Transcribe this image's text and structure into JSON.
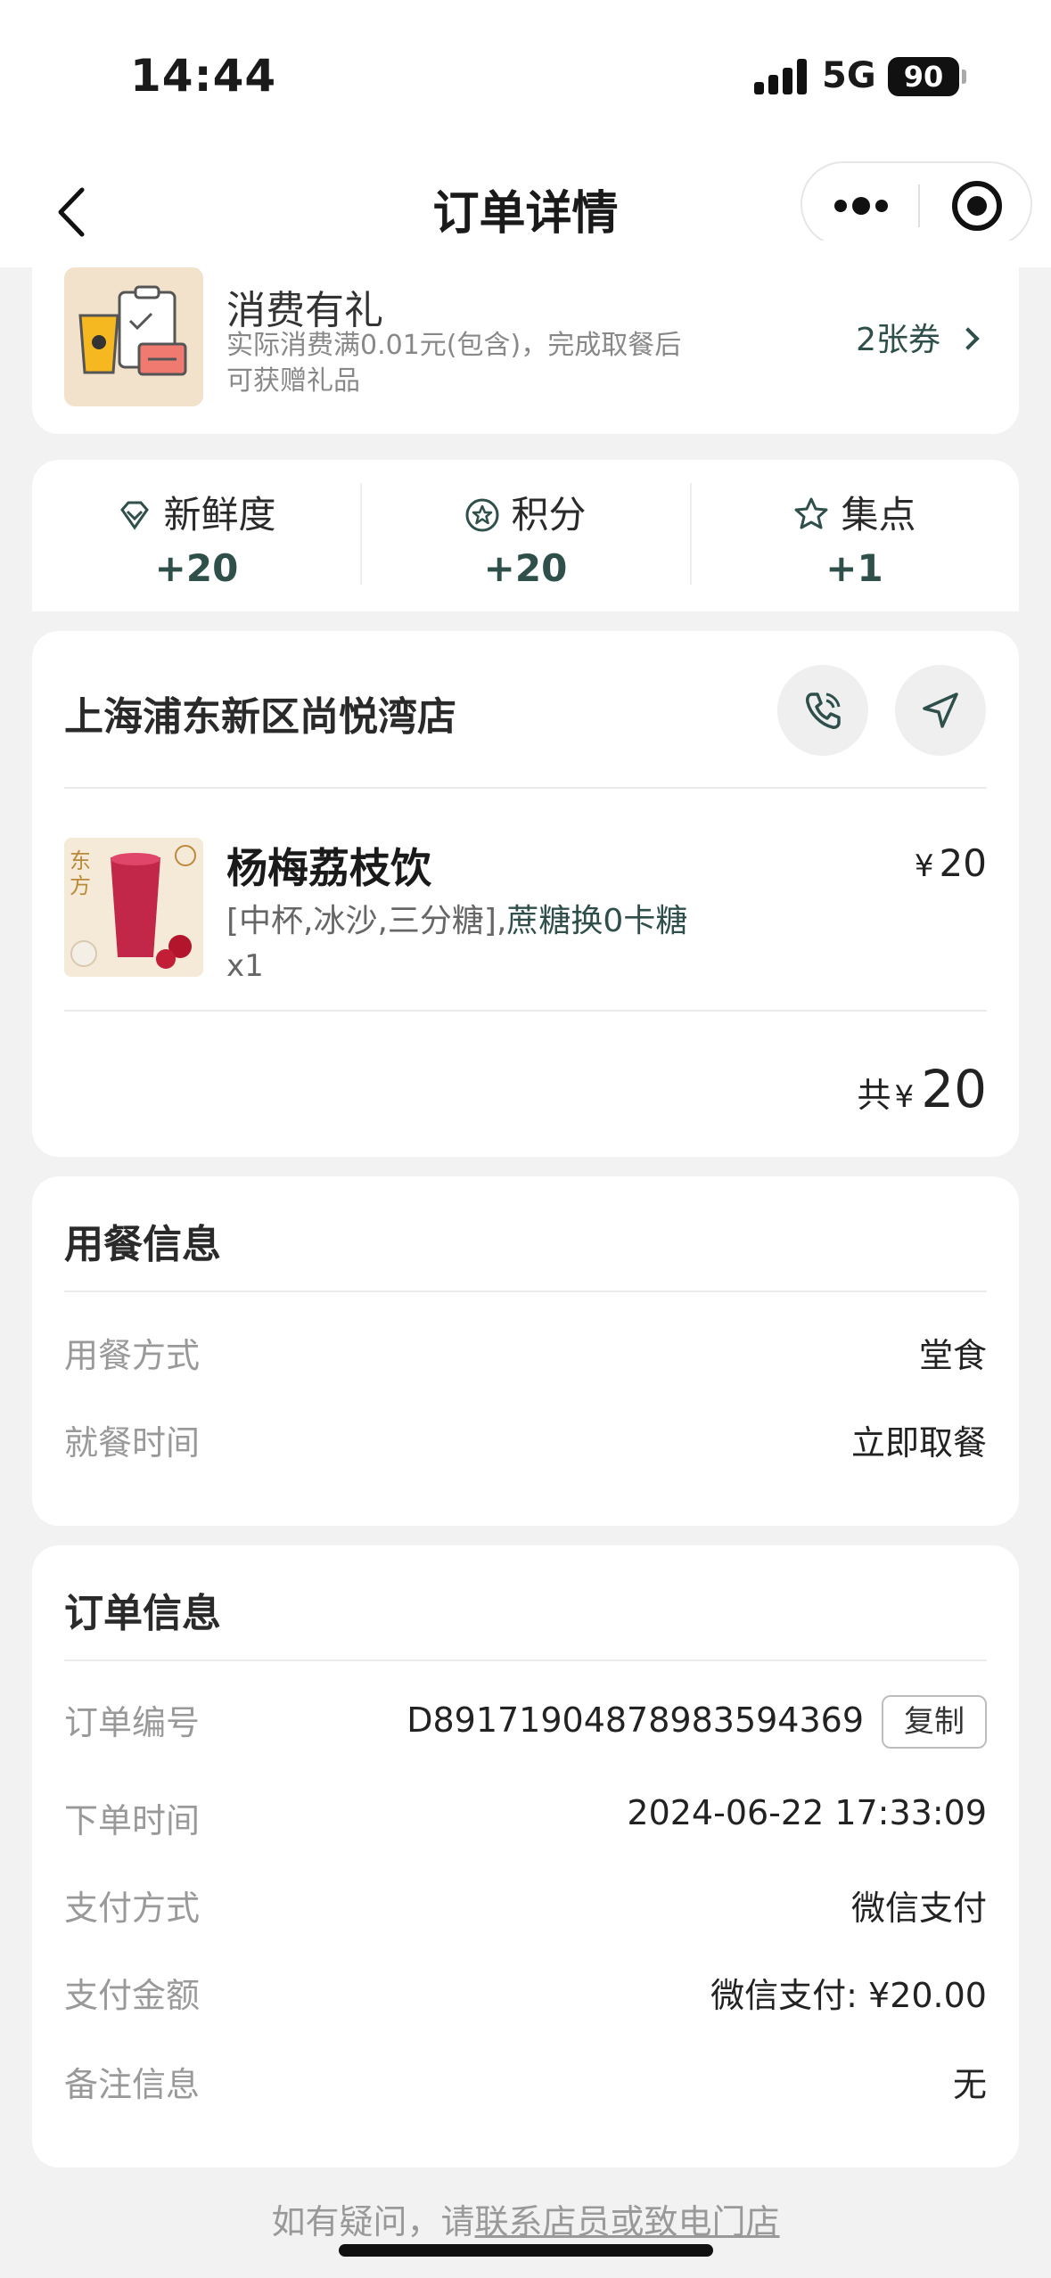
{
  "status": {
    "time": "14:44",
    "network": "5G",
    "battery": "90"
  },
  "nav": {
    "title": "订单详情"
  },
  "gift": {
    "title": "消费有礼",
    "desc": "实际消费满0.01元(包含)，完成取餐后可获赠礼品",
    "coupons": "2张券"
  },
  "stats": [
    {
      "label": "新鲜度",
      "value": "+20",
      "icon": "diamond-icon"
    },
    {
      "label": "积分",
      "value": "+20",
      "icon": "star-circle-icon"
    },
    {
      "label": "集点",
      "value": "+1",
      "icon": "star-icon"
    }
  ],
  "order": {
    "store": "上海浦东新区尚悦湾店",
    "product": {
      "name": "杨梅荔枝饮",
      "options": "[中杯,冰沙,三分糖],",
      "options_highlight": "蔗糖换0卡糖",
      "qty": "x1",
      "currency": "¥",
      "price": "20"
    },
    "total_label": "共",
    "total_currency": "¥",
    "total": "20"
  },
  "dine": {
    "title": "用餐信息",
    "rows": [
      {
        "label": "用餐方式",
        "value": "堂食"
      },
      {
        "label": "就餐时间",
        "value": "立即取餐"
      }
    ]
  },
  "info": {
    "title": "订单信息",
    "order_no_label": "订单编号",
    "order_no": "D89171904878983594369",
    "copy": "复制",
    "rows": [
      {
        "label": "下单时间",
        "value": "2024-06-22 17:33:09"
      },
      {
        "label": "支付方式",
        "value": "微信支付"
      },
      {
        "label": "支付金额",
        "value": "微信支付: ¥20.00"
      },
      {
        "label": "备注信息",
        "value": "无"
      }
    ]
  },
  "footer": {
    "prefix": "如有疑问，请",
    "link": "联系店员或致电门店"
  },
  "colors": {
    "accent": "#2e4f4a",
    "background": "#f2f2f2"
  }
}
